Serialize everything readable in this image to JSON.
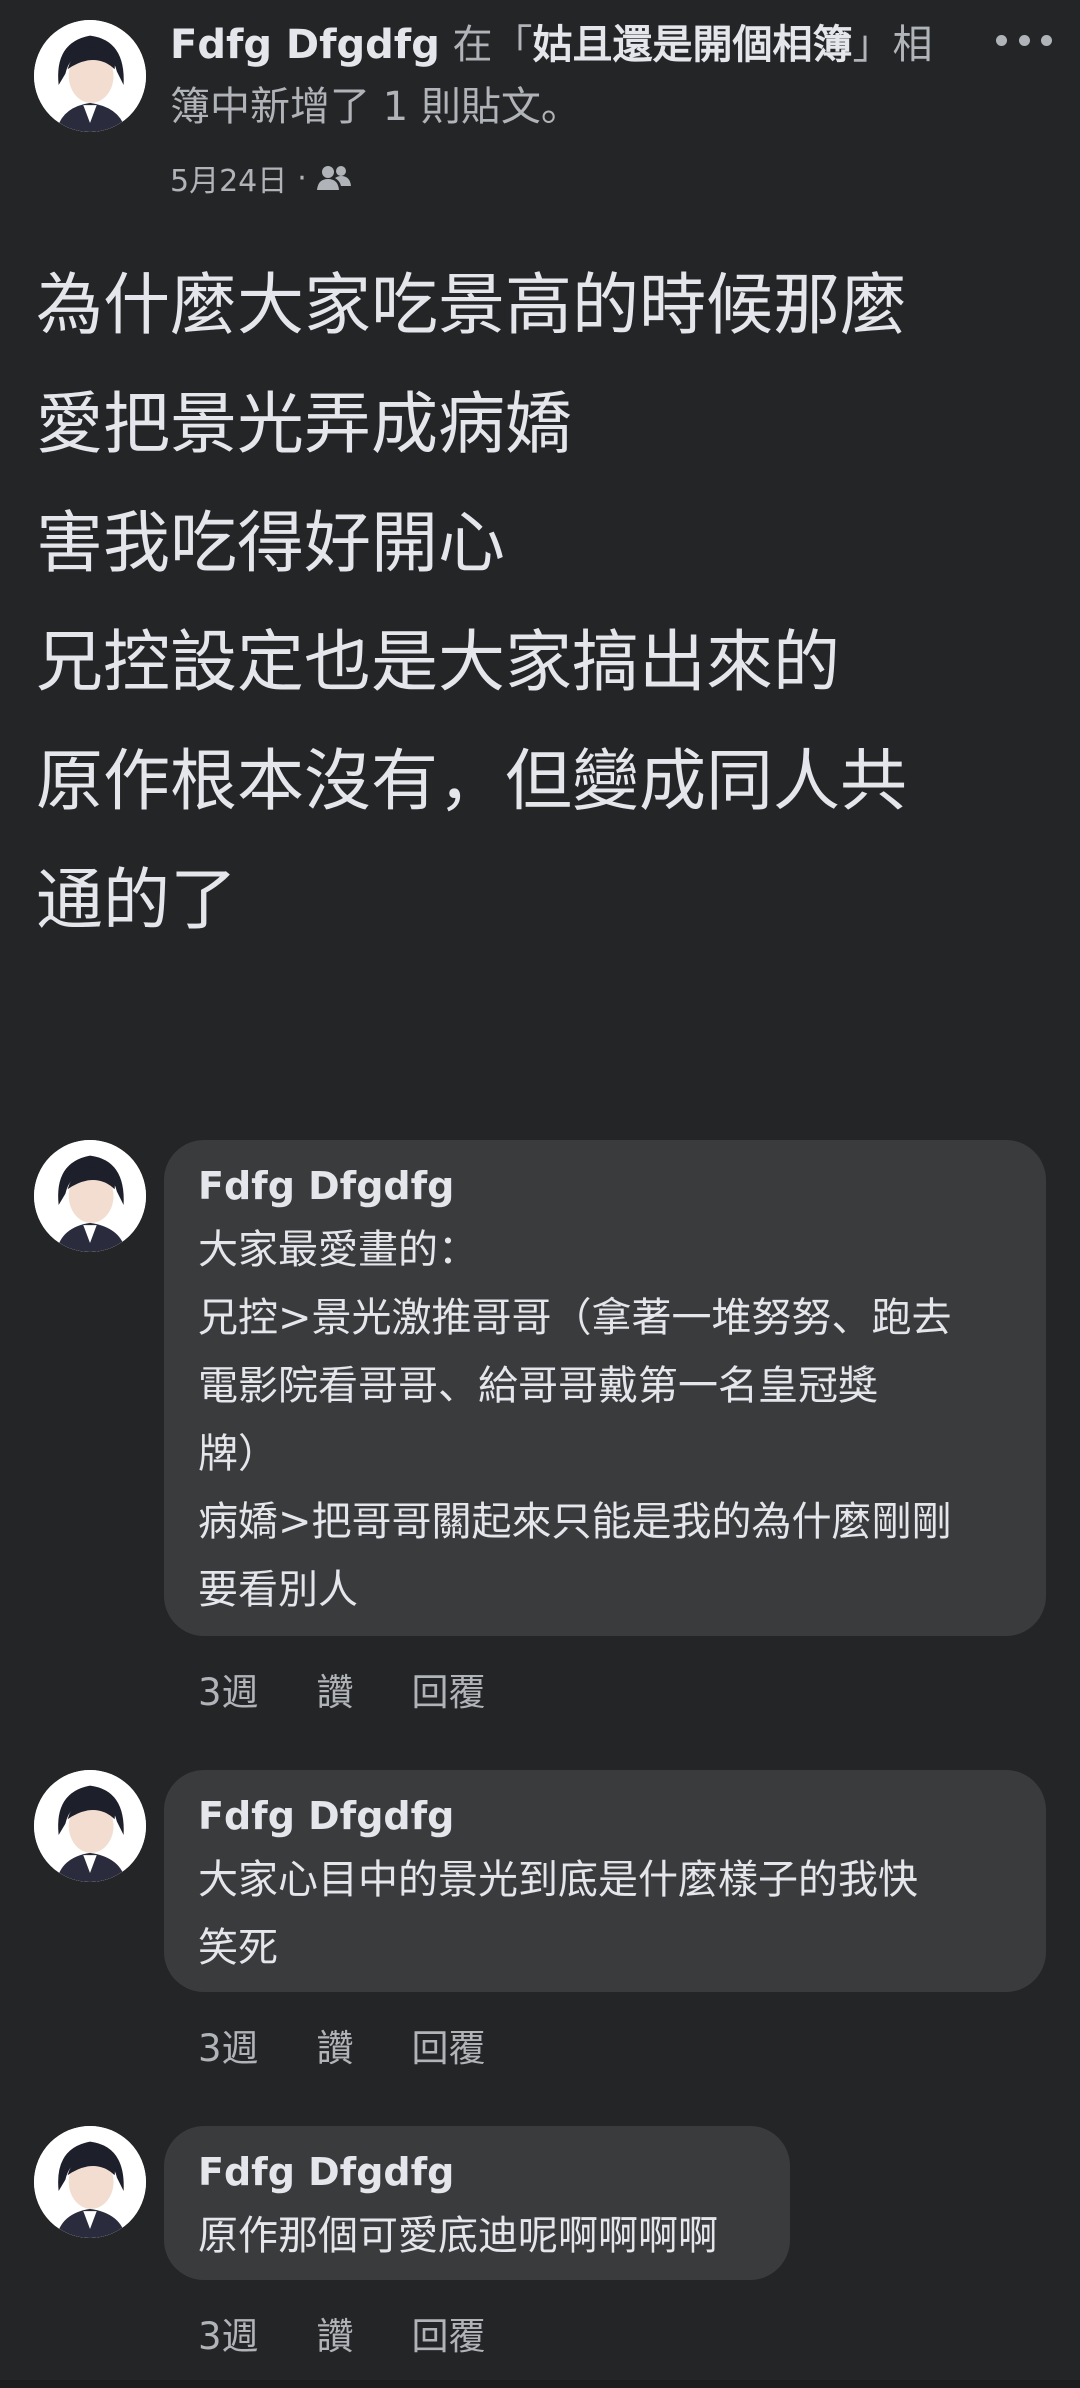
{
  "post": {
    "author": "Fdfg Dfgdfg",
    "header_prefix": " 在「",
    "album": "姑且還是開個相簿",
    "header_suffix_line1": "」相",
    "header_line2": "簿中新增了 1 則貼文。",
    "date": "5月24日",
    "separator": "·",
    "privacy_icon": "friends-icon",
    "more_icon": "more-dots-icon",
    "body_lines": [
      "為什麼大家吃景高的時候那麼",
      "愛把景光弄成病嬌",
      "害我吃得好開心",
      "兄控設定也是大家搞出來的",
      "原作根本沒有，但變成同人共",
      "通的了"
    ]
  },
  "comments": [
    {
      "author": "Fdfg Dfgdfg",
      "lines": [
        "大家最愛畫的：",
        "兄控>景光激推哥哥（拿著一堆努努、跑去",
        "電影院看哥哥、給哥哥戴第一名皇冠獎",
        "牌）",
        "病嬌>把哥哥關起來只能是我的為什麼剛剛",
        "要看別人"
      ],
      "time": "3週",
      "like": "讚",
      "reply": "回覆"
    },
    {
      "author": "Fdfg Dfgdfg",
      "lines": [
        "大家心目中的景光到底是什麼樣子的我快",
        "笑死"
      ],
      "time": "3週",
      "like": "讚",
      "reply": "回覆"
    },
    {
      "author": "Fdfg Dfgdfg",
      "lines": [
        "原作那個可愛底迪呢啊啊啊啊"
      ],
      "time": "3週",
      "like": "讚",
      "reply": "回覆"
    }
  ],
  "colors": {
    "background": "#242526",
    "bubble": "#3a3b3c",
    "primary_text": "#e4e6eb",
    "secondary_text": "#b0b3b8"
  }
}
